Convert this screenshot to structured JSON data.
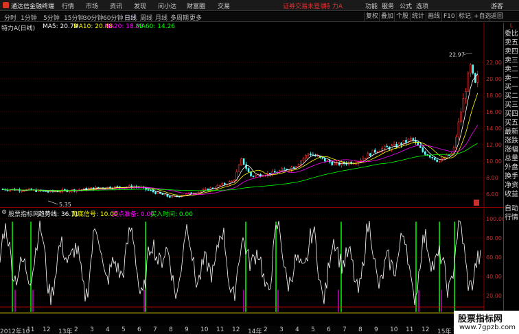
{
  "app": {
    "title": "通达信金融终端"
  },
  "menu": [
    "行情",
    "市场",
    "资讯",
    "发现",
    "问小达",
    "财富圈",
    "交易"
  ],
  "notice": "证券交易未登录",
  "stock_label": "特 力A",
  "top_right": [
    "功能",
    "服务",
    "公式",
    "选项",
    "游客"
  ],
  "period_tabs": [
    "分时",
    "1分钟",
    "5分钟",
    "15分钟",
    "30分钟",
    "60分钟",
    "日线",
    "周线",
    "月线",
    "多周期",
    "更多"
  ],
  "active_tab": "日线",
  "toolbar": [
    "复权",
    "叠加",
    "个股",
    "统计",
    "画线",
    "F10",
    "标记",
    "+自选",
    "返回"
  ],
  "legend": {
    "name": "特力A(日线)",
    "ma5": "MA5: 20.79",
    "ma10": "MA10: 20.48",
    "ma20": "MA20: 18.83",
    "ma60": "MA60: 14.26"
  },
  "annotations": {
    "high": "22.97",
    "low": "5.35"
  },
  "price_axis": [
    "22.00",
    "20.00",
    "18.00",
    "16.00",
    "14.00",
    "12.00",
    "10.00",
    "8.00",
    "6.00"
  ],
  "indicator": {
    "name": "股票指标网",
    "trend": "趋势线: 36.71",
    "bottom": "见底信号: 10.00",
    "prep": "买点准备: 0.00",
    "buy": "买入时间: 0.00"
  },
  "ind_axis": [
    "100.00",
    "80.00",
    "60.00",
    "40.00",
    "20.00"
  ],
  "x_axis": [
    "2012年10",
    "11",
    "12",
    "13年",
    "2",
    "3",
    "4",
    "5",
    "6",
    "7",
    "8",
    "9",
    "10",
    "11",
    "12",
    "14年",
    "2",
    "3",
    "4",
    "5",
    "6",
    "7",
    "8",
    "9",
    "10",
    "11",
    "12",
    "15年",
    "2",
    "3",
    "4"
  ],
  "right_panel": {
    "top": "L",
    "items": [
      "委比",
      "卖五",
      "卖四",
      "卖三",
      "卖二",
      "卖一",
      "买一",
      "买二",
      "买三",
      "买四",
      "买五",
      "最新",
      "涨跌",
      "涨幅",
      "总量",
      "外盘",
      "换手",
      "净资",
      "收益"
    ],
    "bottom": [
      "自动",
      "行情"
    ]
  },
  "watermark": {
    "line1": "股票指标网",
    "line2": "www.7gpzb.com"
  },
  "colors": {
    "up": "#ff3232",
    "down": "#54ffff",
    "ma5": "#ffffff",
    "ma10": "#ffff00",
    "ma20": "#ff00ff",
    "ma60": "#00ff00",
    "trend": "#ffffff",
    "signal": "#00ff00",
    "prep": "#ff00ff"
  }
}
